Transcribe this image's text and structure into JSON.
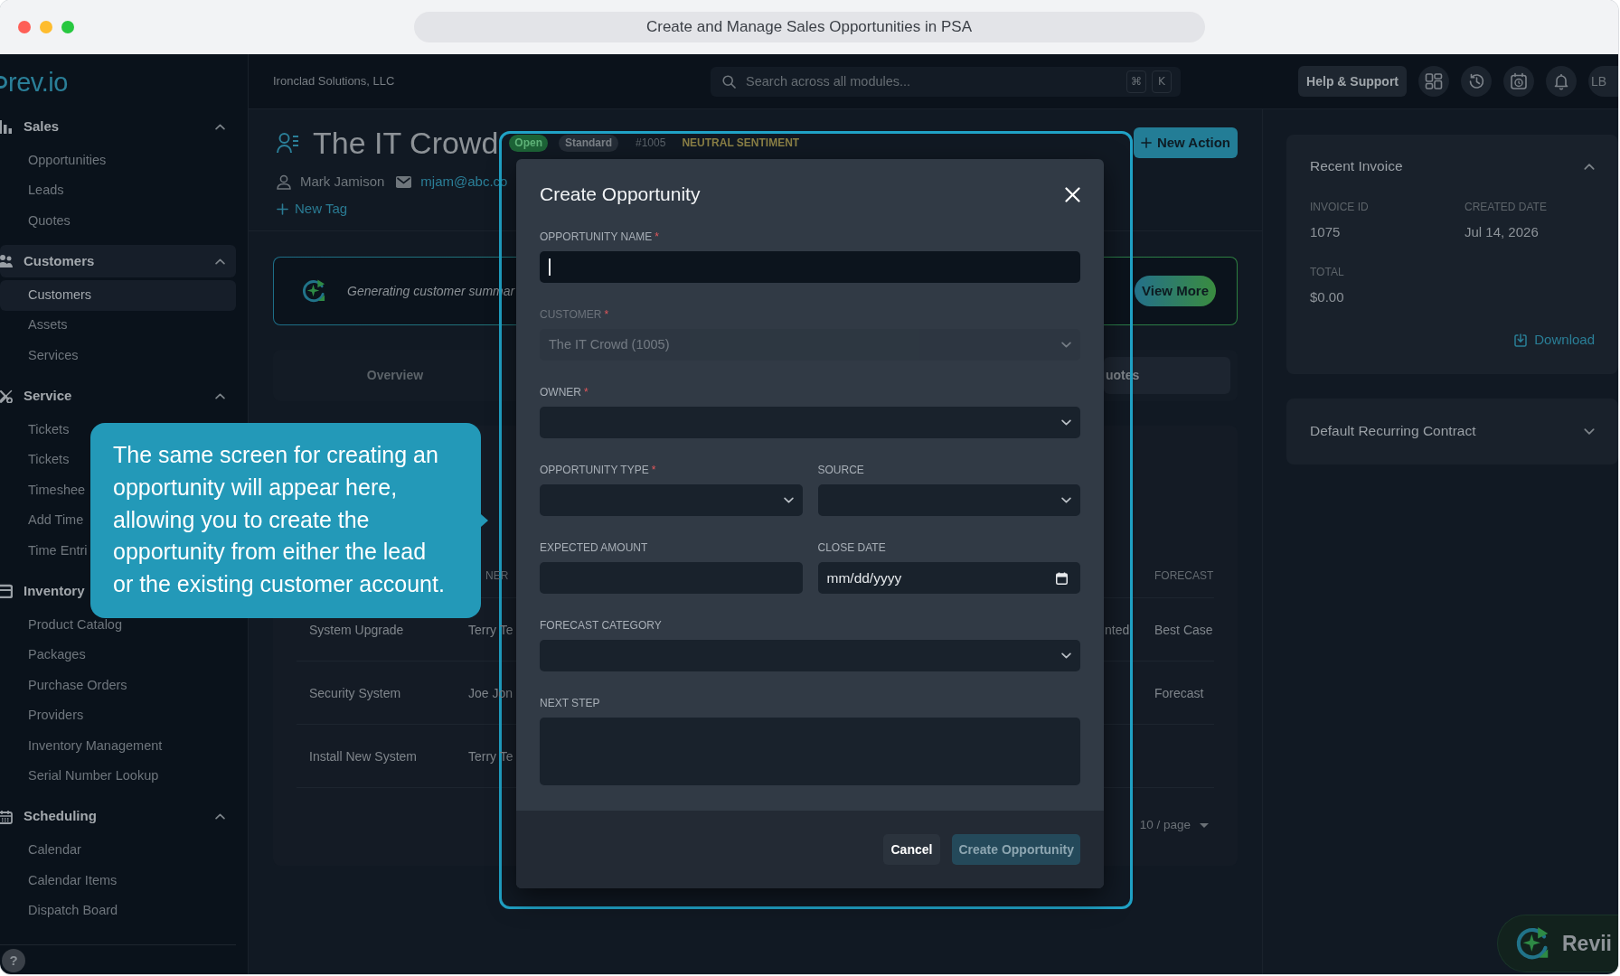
{
  "window": {
    "title": "Create and Manage Sales Opportunities in PSA"
  },
  "sidebar": {
    "logo": "rev.io",
    "sections": [
      {
        "label": "Sales",
        "selected": false,
        "expanded": true,
        "items": [
          {
            "label": "Opportunities",
            "selected": false
          },
          {
            "label": "Leads",
            "selected": false
          },
          {
            "label": "Quotes",
            "selected": false
          }
        ]
      },
      {
        "label": "Customers",
        "selected": true,
        "expanded": true,
        "items": [
          {
            "label": "Customers",
            "selected": true
          },
          {
            "label": "Assets",
            "selected": false
          },
          {
            "label": "Services",
            "selected": false
          }
        ]
      },
      {
        "label": "Service",
        "selected": false,
        "expanded": true,
        "items": [
          {
            "label": "Tickets",
            "selected": false
          },
          {
            "label": "Tickets",
            "selected": false
          },
          {
            "label": "Timeshee",
            "selected": false
          },
          {
            "label": "Add Time",
            "selected": false
          },
          {
            "label": "Time Entri",
            "selected": false
          }
        ]
      },
      {
        "label": "Inventory",
        "selected": false,
        "items": [
          {
            "label": "Product Catalog",
            "selected": false
          },
          {
            "label": "Packages",
            "selected": false
          },
          {
            "label": "Purchase Orders",
            "selected": false
          },
          {
            "label": "Providers",
            "selected": false
          },
          {
            "label": "Inventory Management",
            "selected": false
          },
          {
            "label": "Serial Number Lookup",
            "selected": false
          }
        ]
      },
      {
        "label": "Scheduling",
        "selected": false,
        "expanded": true,
        "items": [
          {
            "label": "Calendar",
            "selected": false
          },
          {
            "label": "Calendar Items",
            "selected": false
          },
          {
            "label": "Dispatch Board",
            "selected": false
          }
        ]
      }
    ],
    "help": "?"
  },
  "topbar": {
    "company": "Ironclad Solutions, LLC",
    "search": {
      "placeholder": "Search across all modules...",
      "keys": [
        "⌘",
        "K"
      ]
    },
    "help_button": "Help & Support",
    "avatar": "LB"
  },
  "customer": {
    "name": "The IT Crowd",
    "badges": [
      {
        "label": "Open",
        "kind": "status"
      },
      {
        "label": "Standard",
        "kind": "tier"
      },
      {
        "label": "#1005",
        "kind": "number"
      },
      {
        "label": "NEUTRAL SENTIMENT",
        "kind": "sentiment"
      }
    ],
    "contact": "Mark Jamison",
    "email": "mjam@abc.co",
    "new_tag": "New Tag",
    "new_action": "New Action"
  },
  "summary": {
    "text": "Generating customer summar",
    "button": "View More"
  },
  "tabs": [
    {
      "label": "Overview",
      "selected": false
    },
    {
      "label": "uotes",
      "selected": true
    }
  ],
  "table": {
    "headers": {
      "column_2": "NER",
      "column_4": "FORECAST"
    },
    "rows": [
      {
        "column_1": "System Upgrade",
        "column_2": "Terry Te",
        "column_3": "nted",
        "column_4": "Best Case"
      },
      {
        "column_1": "Security System",
        "column_2": "Joe Jon",
        "column_4": "Forecast"
      },
      {
        "column_1": "Install New System",
        "column_2": "Terry Te"
      }
    ],
    "page_size": "10 / page"
  },
  "right_panel": {
    "recent_invoice": {
      "title": "Recent Invoice",
      "expanded": true,
      "fields": [
        {
          "label": "INVOICE ID",
          "value": "1075"
        },
        {
          "label": "CREATED DATE",
          "value": "Jul 14, 2026"
        },
        {
          "label": "TOTAL",
          "value": "$0.00"
        }
      ],
      "action": "Download"
    },
    "recurring_contract": {
      "title": "Default Recurring Contract",
      "expanded": false
    }
  },
  "modal": {
    "title": "Create Opportunity",
    "rows": [
      [
        {
          "label": "OPPORTUNITY NAME",
          "required_mark": "*",
          "kind": "text",
          "focused": true,
          "disabled": false
        }
      ],
      [
        {
          "label": "CUSTOMER",
          "required_mark": "*",
          "kind": "select",
          "value": "The IT Crowd (1005)",
          "focused": false,
          "disabled": true
        }
      ],
      [
        {
          "label": "OWNER",
          "required_mark": "*",
          "kind": "select",
          "focused": false,
          "disabled": false
        }
      ],
      [
        {
          "label": "OPPORTUNITY TYPE",
          "required_mark": "*",
          "kind": "select",
          "focused": false,
          "disabled": false
        },
        {
          "label": "SOURCE",
          "kind": "select",
          "focused": false,
          "disabled": false
        }
      ],
      [
        {
          "label": "EXPECTED AMOUNT",
          "kind": "text",
          "focused": false,
          "disabled": false
        },
        {
          "label": "CLOSE DATE",
          "kind": "date",
          "placeholder": "mm/dd/yyyy",
          "focused": false,
          "disabled": false
        }
      ],
      [
        {
          "label": "FORECAST CATEGORY",
          "kind": "select",
          "focused": false,
          "disabled": false
        }
      ],
      [
        {
          "label": "NEXT STEP",
          "kind": "textarea",
          "focused": false,
          "disabled": false
        }
      ]
    ],
    "buttons": [
      {
        "label": "Cancel",
        "kind": "secondary",
        "disabled": false
      },
      {
        "label": "Create Opportunity",
        "kind": "primary",
        "disabled": true
      }
    ]
  },
  "tooltip": {
    "lines": [
      "The same screen for creating an",
      "opportunity will appear here,",
      "allowing you to create the",
      "opportunity from either the lead",
      "or the existing customer account."
    ]
  },
  "assistant_button": {
    "label": "Revii"
  }
}
